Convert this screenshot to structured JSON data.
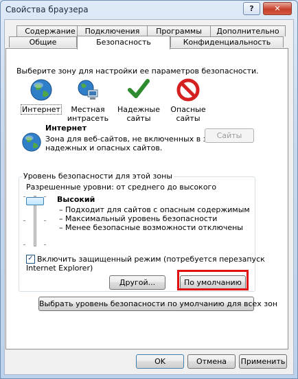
{
  "window": {
    "title": "Свойства браузера",
    "help_label": "?",
    "close_label": "✕"
  },
  "tabs": {
    "row1": [
      "Содержание",
      "Подключения",
      "Программы",
      "Дополнительно"
    ],
    "row2": [
      "Общие",
      "Безопасность",
      "Конфиденциальность"
    ],
    "active": "Безопасность"
  },
  "security": {
    "instruction": "Выберите зону для настройки ее параметров безопасности.",
    "zones": [
      {
        "label_lines": [
          "Интернет"
        ],
        "icon": "globe-icon",
        "selected": true
      },
      {
        "label_lines": [
          "Местная",
          "интрасеть"
        ],
        "icon": "intranet-icon",
        "selected": false
      },
      {
        "label_lines": [
          "Надежные",
          "сайты"
        ],
        "icon": "checkmark-icon",
        "selected": false
      },
      {
        "label_lines": [
          "Опасные",
          "сайты"
        ],
        "icon": "no-entry-icon",
        "selected": false
      }
    ],
    "zone_title": "Интернет",
    "zone_desc_1": "Зона для веб-сайтов, не включенных в зоны",
    "zone_desc_2": "надежных и опасных сайтов.",
    "sites_button": "Сайты",
    "level_group_title": "Уровень безопасности для этой зоны",
    "allowed_levels": "Разрешенные уровни: от среднего до высокого",
    "level_name": "Высокий",
    "level_points": [
      "– Подходит для сайтов с опасным содержимым",
      "– Максимальный уровень безопасности",
      "– Менее безопасные возможности отключены"
    ],
    "protected_mode_1": "Включить защищенный режим (потребуется перезапуск",
    "protected_mode_2": "Internet Explorer)",
    "protected_mode_checked": true,
    "custom_button": "Другой...",
    "default_button": "По умолчанию",
    "reset_all_button": "Выбрать уровень безопасности по умолчанию для всех зон"
  },
  "footer": {
    "ok": "OK",
    "cancel": "Отмена",
    "apply": "Применить"
  },
  "colors": {
    "highlight": "#e01010",
    "globe": "#2f7fc8",
    "check": "#2e8b2e",
    "no_entry": "#d42020"
  }
}
